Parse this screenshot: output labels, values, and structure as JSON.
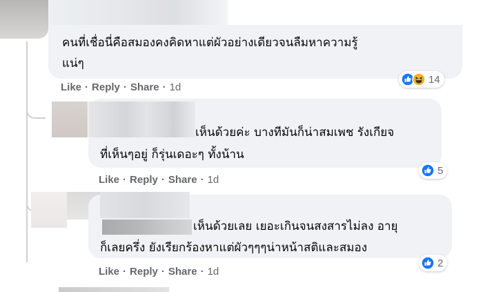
{
  "comments": [
    {
      "text_lines": [
        "คนที่เชื่อนี่คือสมองคงคิดหาแต่ผัวอย่างเดียวจนลืมหาความรู้",
        "แน่ๆ"
      ],
      "actions": {
        "like": "Like",
        "reply": "Reply",
        "share": "Share",
        "time": "1d"
      },
      "reactions": {
        "icons": [
          "like-icon",
          "haha-icon"
        ],
        "count": "14"
      }
    },
    {
      "text_lines": [
        "เห็นด้วยค่ะ บางทีมันก็น่าสมเพช รังเกียจ",
        "ที่เห็นๆอยู่ ก็รุ่นเดอะๆ ทั้งน้าน"
      ],
      "actions": {
        "like": "Like",
        "reply": "Reply",
        "share": "Share",
        "time": "1d"
      },
      "reactions": {
        "icons": [
          "like-icon"
        ],
        "count": "5"
      }
    },
    {
      "text_lines": [
        "เห็นด้วยเลย เยอะเกินจนสงสารไม่ลง อายุ",
        "ก็เลยครึ่ง ยังเรียกร้องหาแต่ผัวๆๆๆน่าหน้าสติและสมอง"
      ],
      "actions": {
        "like": "Like",
        "reply": "Reply",
        "share": "Share",
        "time": "1d"
      },
      "reactions": {
        "icons": [
          "like-icon"
        ],
        "count": "2"
      }
    }
  ],
  "colors": {
    "bubble": "#f0f2f5",
    "action_text": "#65676b",
    "like_blue": "#1877f2",
    "haha_yellow": "#f7b125"
  }
}
